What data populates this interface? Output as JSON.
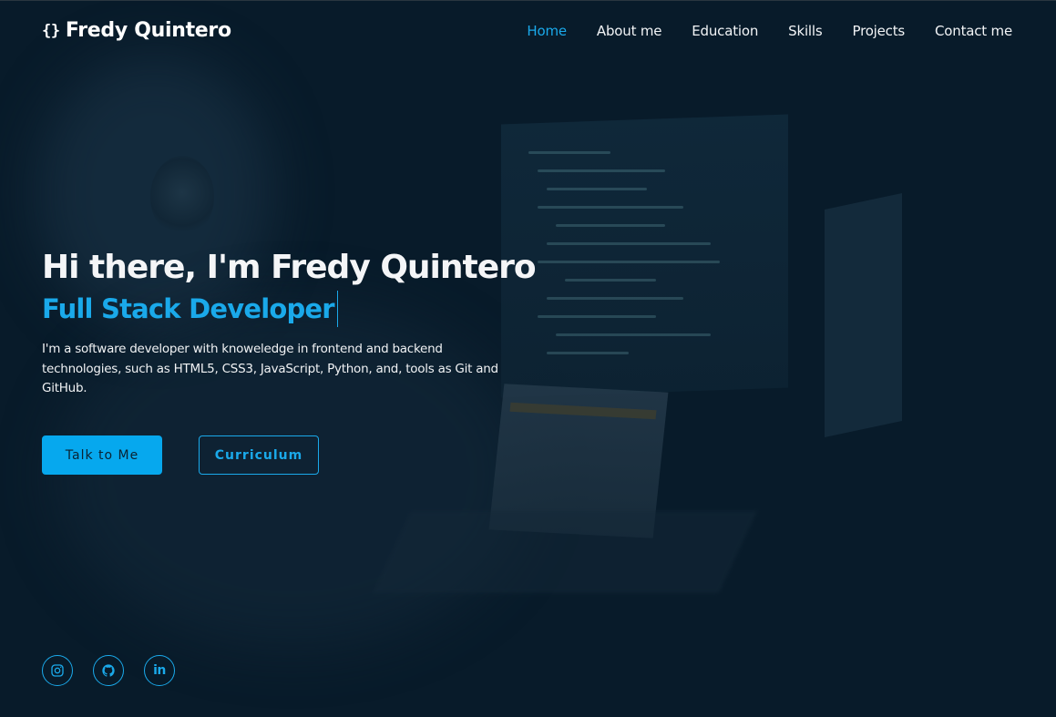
{
  "brand": {
    "icon": "{}",
    "name": "Fredy Quintero"
  },
  "nav": {
    "items": [
      {
        "label": "Home",
        "active": true
      },
      {
        "label": "About me",
        "active": false
      },
      {
        "label": "Education",
        "active": false
      },
      {
        "label": "Skills",
        "active": false
      },
      {
        "label": "Projects",
        "active": false
      },
      {
        "label": "Contact me",
        "active": false
      }
    ]
  },
  "hero": {
    "title": "Hi there, I'm Fredy Quintero",
    "role": "Full Stack Developer",
    "description": "I'm a software developer with knoweledge in frontend and backend technologies, such as HTML5, CSS3, JavaScript, Python, and, tools as Git and GitHub."
  },
  "buttons": {
    "primary_label": "Talk to Me",
    "secondary_label": "Curriculum"
  },
  "socials": [
    {
      "icon": "instagram-icon"
    },
    {
      "icon": "github-icon"
    },
    {
      "icon": "linkedin-icon",
      "glyph": "in"
    }
  ],
  "colors": {
    "accent": "#1aa9ea",
    "background": "#081b2a",
    "text": "#f4f5f7"
  }
}
